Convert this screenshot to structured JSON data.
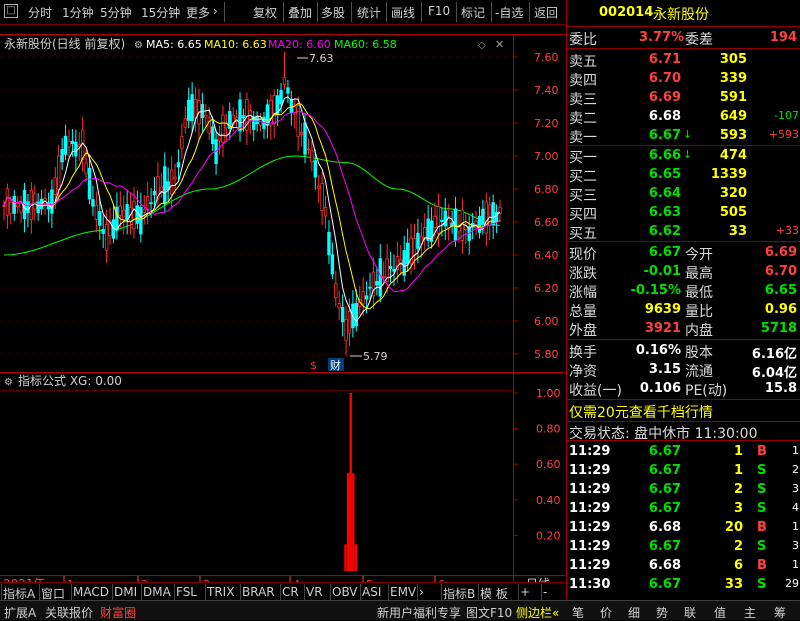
{
  "toolbar": {
    "left": [
      "分时",
      "1分钟",
      "5分钟",
      "15分钟",
      "更多"
    ],
    "more_arrow": "›",
    "right": [
      "复权",
      "叠加",
      "多股",
      "统计",
      "画线",
      "F10",
      "标记",
      "-自选",
      "返回"
    ]
  },
  "chart_header": {
    "name": "永新股份(日线 前复权)",
    "ma5": "MA5: 6.65",
    "ma10": "MA10: 6.63",
    "ma20": "MA20: 6.60",
    "ma60": "MA60: 6.58"
  },
  "price_axis": [
    "7.60",
    "7.40",
    "7.20",
    "7.00",
    "6.80",
    "6.60",
    "6.40",
    "6.20",
    "6.00",
    "5.80"
  ],
  "annotations": {
    "high": "7.63",
    "low": "5.79",
    "cai": "财"
  },
  "indicator": {
    "title": "指标公式 XG: 0.00",
    "axis": [
      "1.00",
      "0.80",
      "0.60",
      "0.40",
      "0.20"
    ]
  },
  "date_axis": {
    "year": "2021年",
    "months": [
      "1",
      "2",
      "3",
      "4",
      "5",
      "6"
    ],
    "right": "日线"
  },
  "chart_data": {
    "type": "candlestick",
    "price_ylim": [
      5.72,
      7.72
    ],
    "high": 7.63,
    "low": 5.79,
    "ma_latest": {
      "MA5": 6.65,
      "MA10": 6.63,
      "MA20": 6.6,
      "MA60": 6.58
    },
    "indicator_xg": {
      "ylim": [
        0,
        1.1
      ],
      "signal_value": 1.0,
      "latest": 0.0
    }
  },
  "tabs": [
    "指标A",
    "窗口",
    "MACD",
    "DMI",
    "DMA",
    "FSL",
    "TRIX",
    "BRAR",
    "CR",
    "VR",
    "OBV",
    "ASI",
    "EMV",
    "›",
    "指标B",
    "模 板",
    "+",
    "-"
  ],
  "quote": {
    "code": "002014",
    "name": "永新股份",
    "weibi_label": "委比",
    "weibi": "3.77%",
    "weicha_label": "委差",
    "weicha": "194",
    "asks": [
      {
        "l": "卖五",
        "p": "6.71",
        "v": "305",
        "c": ""
      },
      {
        "l": "卖四",
        "p": "6.70",
        "v": "339",
        "c": ""
      },
      {
        "l": "卖三",
        "p": "6.69",
        "v": "591",
        "c": ""
      },
      {
        "l": "卖二",
        "p": "6.68",
        "v": "649",
        "c": "-107"
      },
      {
        "l": "卖一",
        "p": "6.67",
        "v": "593",
        "c": "+593"
      }
    ],
    "bids": [
      {
        "l": "买一",
        "p": "6.66",
        "v": "474",
        "c": ""
      },
      {
        "l": "买二",
        "p": "6.65",
        "v": "1339",
        "c": ""
      },
      {
        "l": "买三",
        "p": "6.64",
        "v": "320",
        "c": ""
      },
      {
        "l": "买四",
        "p": "6.63",
        "v": "505",
        "c": ""
      },
      {
        "l": "买五",
        "p": "6.62",
        "v": "33",
        "c": "+33"
      }
    ],
    "stats": [
      {
        "l1": "现价",
        "v1": "6.67",
        "l2": "今开",
        "v2": "6.69"
      },
      {
        "l1": "涨跌",
        "v1": "-0.01",
        "l2": "最高",
        "v2": "6.70"
      },
      {
        "l1": "涨幅",
        "v1": "-0.15%",
        "l2": "最低",
        "v2": "6.65"
      },
      {
        "l1": "总量",
        "v1": "9639",
        "l2": "量比",
        "v2": "0.96"
      },
      {
        "l1": "外盘",
        "v1": "3921",
        "l2": "内盘",
        "v2": "5718"
      }
    ],
    "fin": [
      {
        "l1": "换手",
        "v1": "0.16%",
        "l2": "股本",
        "v2": "6.16亿"
      },
      {
        "l1": "净资",
        "v1": "3.15",
        "l2": "流通",
        "v2": "6.04亿"
      },
      {
        "l1": "收益(一)",
        "v1": "0.106",
        "l2": "PE(动)",
        "v2": "15.8"
      }
    ],
    "promo": "仅需20元查看千档行情",
    "trade_state": "交易状态: 盘中休市 11:30:00",
    "ticks": [
      {
        "t": "11:29",
        "p": "6.67",
        "v": "1",
        "d": "B",
        "n": "1"
      },
      {
        "t": "11:29",
        "p": "6.67",
        "v": "1",
        "d": "S",
        "n": "2"
      },
      {
        "t": "11:29",
        "p": "6.67",
        "v": "2",
        "d": "S",
        "n": "3"
      },
      {
        "t": "11:29",
        "p": "6.67",
        "v": "3",
        "d": "S",
        "n": "4"
      },
      {
        "t": "11:29",
        "p": "6.68",
        "v": "20",
        "d": "B",
        "n": "1"
      },
      {
        "t": "11:29",
        "p": "6.67",
        "v": "2",
        "d": "S",
        "n": "3"
      },
      {
        "t": "11:29",
        "p": "6.68",
        "v": "6",
        "d": "B",
        "n": "1"
      },
      {
        "t": "11:30",
        "p": "6.67",
        "v": "33",
        "d": "S",
        "n": "29"
      }
    ]
  },
  "status": {
    "left": [
      "扩展A",
      "关联报价",
      "财富圈"
    ],
    "mid": [
      "新用户福利专享",
      "图文F10",
      "侧边栏«"
    ],
    "right": [
      "笔",
      "价",
      "细",
      "势",
      "联",
      "值",
      "主",
      "筹"
    ]
  },
  "colors": {
    "up": "#ff3030",
    "down": "#00ffff",
    "ma5": "#ffffff",
    "ma10": "#ffff00",
    "ma20": "#ff00ff",
    "ma60": "#00ff00",
    "frame": "#b00000"
  }
}
